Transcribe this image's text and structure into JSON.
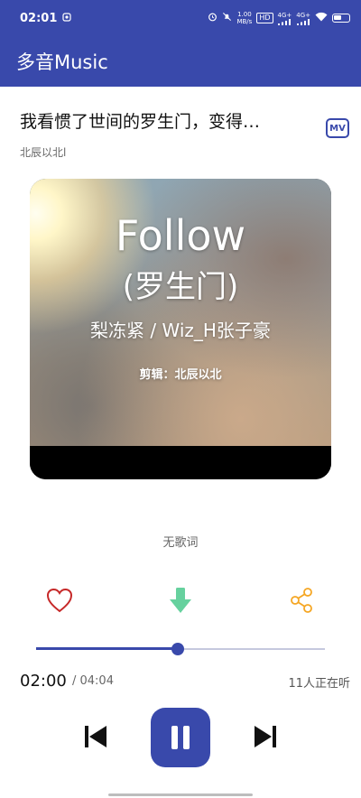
{
  "status_bar": {
    "time": "02:01",
    "net_speed": "1.00",
    "net_unit": "MB/s",
    "hd_label": "HD",
    "signal1": "4G+",
    "signal2": "4G+"
  },
  "app_bar": {
    "title": "多音Music"
  },
  "song": {
    "title": "我看惯了世间的罗生门，变得…",
    "artist": "北辰以北l",
    "mv_label": "MV"
  },
  "cover": {
    "line1": "Follow",
    "line2": "(罗生门)",
    "line3": "梨冻紧 / Wiz_H张子豪",
    "line4": "剪辑：北辰以北"
  },
  "lyrics": {
    "text": "无歌词"
  },
  "actions": {
    "like_icon": "heart-outline-icon",
    "download_icon": "download-arrow-icon",
    "share_icon": "share-icon",
    "like_color": "#c62828",
    "download_color": "#66d19e",
    "share_color": "#f5a623"
  },
  "player": {
    "progress_fraction": 0.49,
    "current_time": "02:00",
    "total_time": "/ 04:04",
    "listeners": "11人正在听"
  },
  "colors": {
    "primary": "#3949ab",
    "track": "#c5c8de"
  }
}
